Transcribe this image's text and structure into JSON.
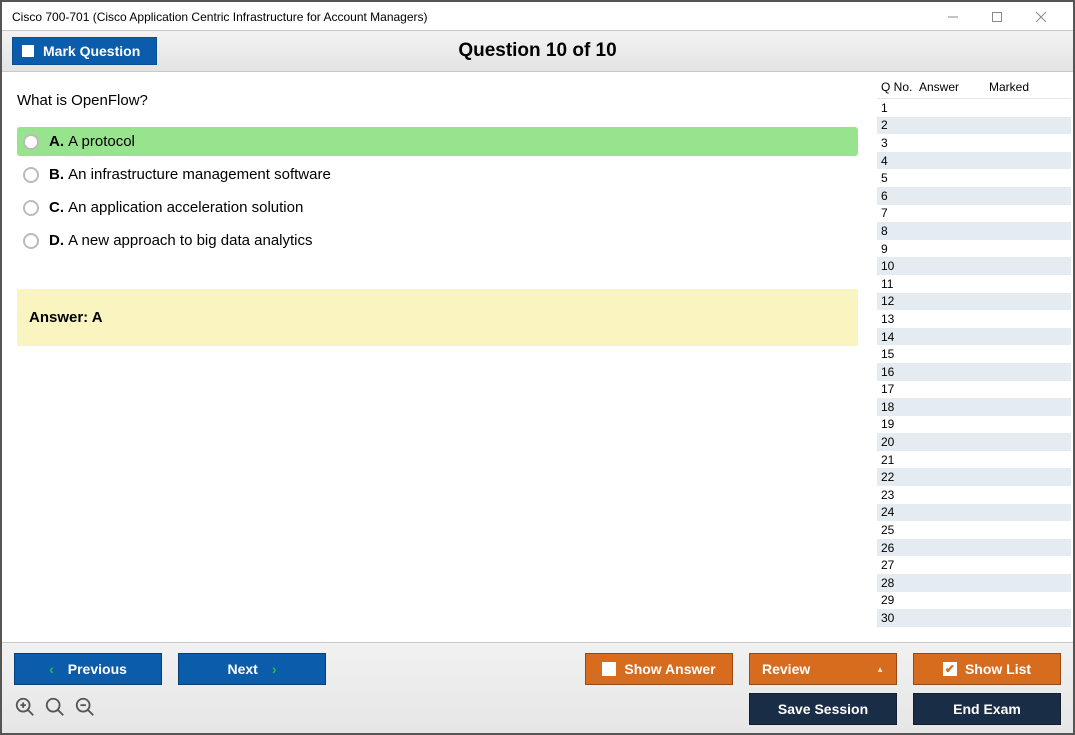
{
  "window": {
    "title": "Cisco 700-701 (Cisco Application Centric Infrastructure for Account Managers)"
  },
  "header": {
    "mark_label": "Mark Question",
    "question_counter": "Question 10 of 10"
  },
  "question": {
    "text": "What is OpenFlow?",
    "choices": [
      {
        "letter": "A.",
        "text": "A protocol",
        "selected": true
      },
      {
        "letter": "B.",
        "text": "An infrastructure management software",
        "selected": false
      },
      {
        "letter": "C.",
        "text": "An application acceleration solution",
        "selected": false
      },
      {
        "letter": "D.",
        "text": "A new approach to big data analytics",
        "selected": false
      }
    ],
    "answer_label": "Answer: A"
  },
  "sidebar": {
    "col_qno": "Q No.",
    "col_answer": "Answer",
    "col_marked": "Marked",
    "rows": [
      1,
      2,
      3,
      4,
      5,
      6,
      7,
      8,
      9,
      10,
      11,
      12,
      13,
      14,
      15,
      16,
      17,
      18,
      19,
      20,
      21,
      22,
      23,
      24,
      25,
      26,
      27,
      28,
      29,
      30
    ]
  },
  "footer": {
    "previous": "Previous",
    "next": "Next",
    "show_answer": "Show Answer",
    "review": "Review",
    "show_list": "Show List",
    "save_session": "Save Session",
    "end_exam": "End Exam"
  }
}
